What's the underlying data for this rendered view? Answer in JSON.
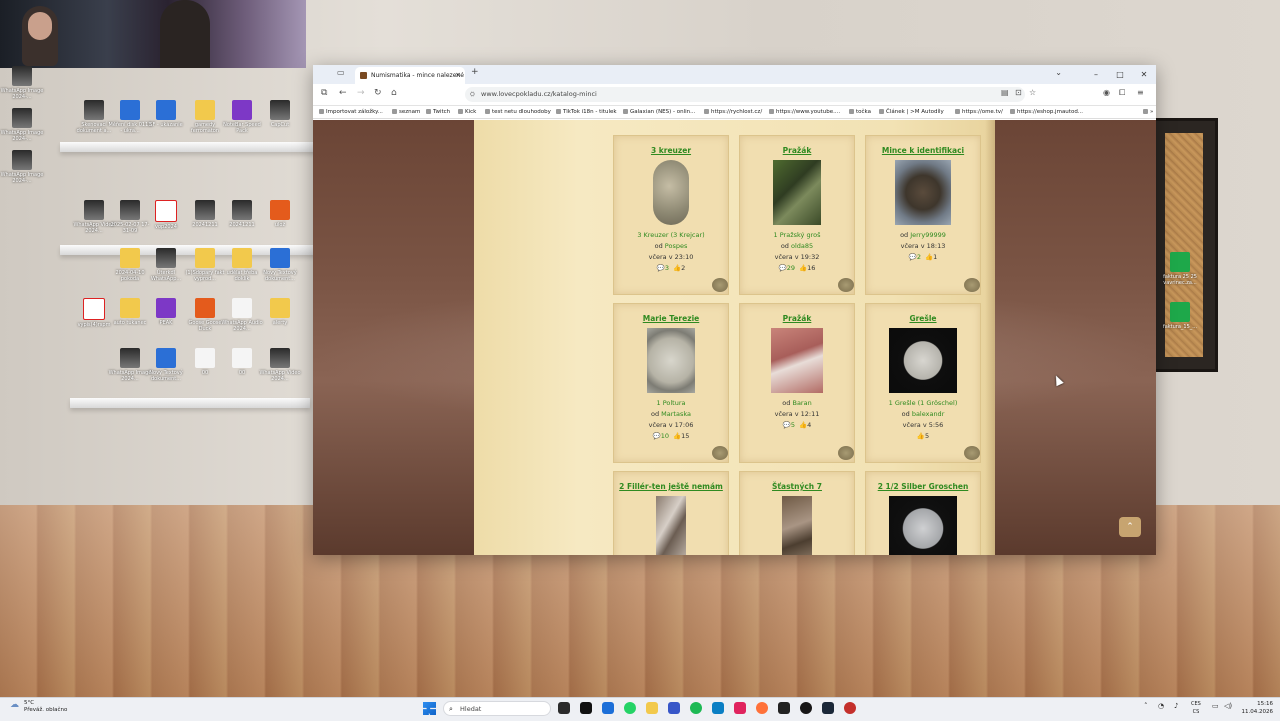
{
  "desktop": {
    "left_icons": [
      {
        "label": "WhatsApp Image 2024-...",
        "kind": "img"
      },
      {
        "label": "WhatsApp Image 2024-...",
        "kind": "img"
      },
      {
        "label": "WhatsApp Image 2024-...",
        "kind": "img"
      }
    ],
    "shelf_icons": [
      {
        "label": "Skenovací dokument a...",
        "kind": "img"
      },
      {
        "label": "Měření disk 0111 - ukra...",
        "kind": "doc"
      },
      {
        "label": "SF - ukázanie",
        "kind": "doc"
      },
      {
        "label": "gamedy ferromaton",
        "kind": "folder"
      },
      {
        "label": "NoteBar Speed Pack",
        "kind": "purple"
      },
      {
        "label": "CapCut",
        "kind": "img"
      },
      {
        "label": "WhatsApp Video 2024...",
        "kind": "img"
      },
      {
        "label": "2025-02-07 17-31-09",
        "kind": "img"
      },
      {
        "label": "vop2024",
        "kind": "pdf"
      },
      {
        "label": "20241211",
        "kind": "img"
      },
      {
        "label": "20241211",
        "kind": "img"
      },
      {
        "label": "ulož",
        "kind": "app"
      },
      {
        "label": "2024-04-10 pokoda",
        "kind": "folder"
      },
      {
        "label": "Úterkdl WhatsApp...",
        "kind": "img"
      },
      {
        "label": "(1)Sdopary fakt vyprod...",
        "kind": "folder"
      },
      {
        "label": "udělat třeba doklik",
        "kind": "folder"
      },
      {
        "label": "Nový Textový dokument...",
        "kind": "doc"
      },
      {
        "label": "vypis(4)rspm",
        "kind": "pdf"
      },
      {
        "label": "auto tukanec",
        "kind": "folder"
      },
      {
        "label": "PEAK",
        "kind": "purple"
      },
      {
        "label": "Goose Goose Duck",
        "kind": "app"
      },
      {
        "label": "WhatsApp Audio 2024...",
        "kind": "blank"
      },
      {
        "label": "alerty",
        "kind": "folder"
      },
      {
        "label": "WhatsApp Image 2024...",
        "kind": "img"
      },
      {
        "label": "Nový Textový dokument...",
        "kind": "doc"
      },
      {
        "label": "00",
        "kind": "blank"
      },
      {
        "label": "00",
        "kind": "blank"
      },
      {
        "label": "WhatsApp Video 2024...",
        "kind": "img"
      }
    ],
    "right_icons": [
      {
        "label": "faktura 25 25 vavrinec.za...",
        "kind": "sheet"
      },
      {
        "label": "faktura_15_...",
        "kind": "sheet"
      }
    ]
  },
  "browser": {
    "tab_title": "Numismatika - mince nalezené",
    "tab_close": "×",
    "new_tab": "+",
    "url": "www.lovecpokladu.cz/katalog-minci",
    "window_controls": [
      "–",
      "□",
      "✕"
    ],
    "bookmarks": [
      "Importovat záložky...",
      "seznam",
      "Twitch",
      "Kick",
      "test netu dlouhodoby",
      "TikTok i18n - titulek",
      "Galaxian (NES) - onlin...",
      "https://rychlost.cz/",
      "https://www.youtube....",
      "točka",
      "Článek | >M Autodíly",
      "https://ome.tv/",
      "https://eshop.jmautod..."
    ]
  },
  "coins": [
    {
      "title": "3 kreuzer",
      "name": "3 Kreuzer (3 Krejcar)",
      "by_prefix": "od",
      "user": "Pospes",
      "time": "včera v 23:10",
      "comments": "3",
      "likes": "2",
      "thumb": "coin"
    },
    {
      "title": "Pražák",
      "name": "1 Pražský groš",
      "by_prefix": "od",
      "user": "olda85",
      "time": "včera v 19:32",
      "comments": "29",
      "likes": "16",
      "thumb": "forest"
    },
    {
      "title": "Mince k identifikaci",
      "name": "",
      "by_prefix": "od",
      "user": "Jerry99999",
      "time": "včera v 18:13",
      "comments": "2",
      "likes": "1",
      "thumb": "dark"
    },
    {
      "title": "Marie Terezie",
      "name": "1 Poltura",
      "by_prefix": "od",
      "user": "Martaska",
      "time": "včera v 17:06",
      "comments": "10",
      "likes": "15",
      "thumb": "silver"
    },
    {
      "title": "Pražák",
      "name": "",
      "by_prefix": "od",
      "user": "Baran",
      "time": "včera v 12:11",
      "comments": "5",
      "likes": "4",
      "thumb": "hand"
    },
    {
      "title": "Grešle",
      "name": "1 Grešle (1 Gröschel)",
      "by_prefix": "od",
      "user": "balexandr",
      "time": "včera v 5:56",
      "comments": "",
      "likes": "5",
      "thumb": "black"
    },
    {
      "title": "2 Fillér-ten ještě nemám",
      "name": "",
      "by_prefix": "",
      "user": "",
      "time": "",
      "comments": "",
      "likes": "",
      "thumb": "rock"
    },
    {
      "title": "Šťastných 7",
      "name": "",
      "by_prefix": "",
      "user": "",
      "time": "",
      "comments": "",
      "likes": "",
      "thumb": "soil"
    },
    {
      "title": "2 1/2 Silber Groschen",
      "name": "",
      "by_prefix": "",
      "user": "",
      "time": "",
      "comments": "",
      "likes": "",
      "thumb": "grosch"
    }
  ],
  "scroll_top_icon": "chevron-up",
  "taskbar": {
    "temperature": "5°C",
    "weather": "Převáž. oblačno",
    "search_placeholder": "Hledat",
    "lang_top": "CES",
    "lang_bottom": "CS",
    "time": "15:16",
    "date": "11.04.2026"
  },
  "colors": {
    "link_green": "#2f8a20",
    "parchment": "#f2e2b4",
    "site_background": "#6b4536"
  }
}
